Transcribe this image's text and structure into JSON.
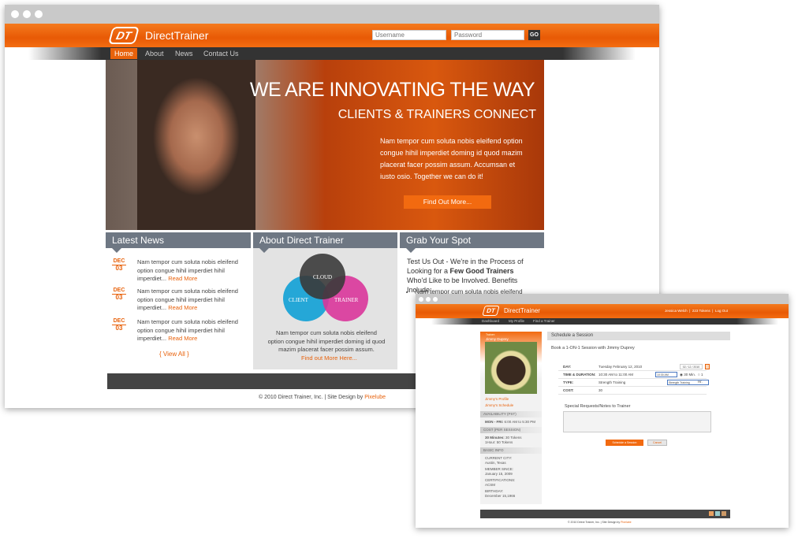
{
  "main_site": {
    "logo": "DirectTrainer",
    "login": {
      "username_placeholder": "Username",
      "password_placeholder": "Password",
      "go": "GO"
    },
    "nav": [
      "Home",
      "About",
      "News",
      "Contact Us"
    ],
    "hero": {
      "title1": "WE ARE INNOVATING THE WAY",
      "title2": "CLIENTS & TRAINERS CONNECT",
      "body": "Nam tempor cum soluta nobis eleifend option congue hihil imperdiet doming id quod mazim placerat facer possim assum. Accumsan et iusto osio. Together we can do it!",
      "cta": "Find Out More..."
    },
    "latest_news": {
      "title": "Latest News",
      "items": [
        {
          "month": "DEC",
          "day": "03",
          "text": "Nam tempor cum soluta nobis eleifend option congue hihil imperdiet hihil imperdiet...",
          "more": "Read More"
        },
        {
          "month": "DEC",
          "day": "03",
          "text": "Nam tempor cum soluta nobis eleifend option congue hihil imperdiet hihil imperdiet...",
          "more": "Read More"
        },
        {
          "month": "DEC",
          "day": "03",
          "text": "Nam tempor cum soluta nobis eleifend option congue hihil imperdiet hihil imperdiet...",
          "more": "Read More"
        }
      ],
      "view_all": "{ View All }"
    },
    "about": {
      "title": "About Direct Trainer",
      "venn": [
        "CLOUD",
        "CLIENT",
        "TRAINER"
      ],
      "body": "Nam tempor cum soluta nobis eleifend option congue hihil imperdiet doming id quod mazim placerat facer possim assum.",
      "more": "Find out More Here..."
    },
    "grab": {
      "title": "Grab Your Spot",
      "intro_a": "Test Us Out - We're in the Process of Looking for a ",
      "intro_bold": "Few Good Trainers",
      "intro_b": " Who'd Like to be Involved. Benefits Include:",
      "bullet": "Nam tempor cum soluta nobis eleifend"
    },
    "footer": {
      "copyright": "© 2010 Direct Trainer, Inc.  |  Site Design by ",
      "designer": "Pixelube"
    }
  },
  "app": {
    "logo": "DirectTrainer",
    "user": "Jessica Welch",
    "tokens": "223 Tokens",
    "logout": "Log Out",
    "nav": [
      "Dashboard",
      "My Profile",
      "Find a Trainer"
    ],
    "trainer": {
      "label": "Trainer:",
      "name": "Jimmy Duprey",
      "links": [
        "Jimmy's Profile",
        "Jimmy's Schedule"
      ],
      "availability_h": "AVAILABILITY (PST)",
      "availability_k": "MON - FRI:",
      "availability_v": "6:00 AM to 5:30 PM",
      "cost_h": "COST (PER SESSION)",
      "cost": [
        [
          "30 Minutes:",
          "30 Tokens"
        ],
        [
          "1Hour:",
          "50 Tokens"
        ]
      ],
      "basic_h": "BASIC INFO",
      "basic": [
        [
          "CURRENT CITY:",
          "Austin, Texas"
        ],
        [
          "MEMBER SINCE:",
          "January 15, 2009"
        ],
        [
          "CERTIFICATIONS:",
          "ACSM"
        ],
        [
          "BIRTHDAY:",
          "December 15,1966"
        ]
      ]
    },
    "schedule": {
      "title": "Schedule a Session",
      "subtitle": "Book a 1-ON-1 Session with Jimmy Duprey",
      "day_l": "DAY:",
      "day_v": "Tuesday February 12, 2010",
      "date_input": "02 / 12 / 2010",
      "time_l": "TIME & DURATION:",
      "time_v": "10:30 AM to 11:00 AM",
      "time_select": "10:30 AM",
      "dur": [
        "30 Min.",
        "1 Hr."
      ],
      "type_l": "TYPE:",
      "type_v": "Strength Training",
      "type_select": "Strength Training",
      "cost_l": "COST:",
      "cost_v": "30",
      "notes_label": "Special Requests/Notes to Trainer",
      "submit": "Schedule a Session",
      "cancel": "Cancel"
    },
    "footer": {
      "copyright": "© 2010 Direct Trainer, Inc.  |  Site Design by ",
      "designer": "Pixelube"
    }
  },
  "colors": {
    "accent": "#e8620c",
    "header_gray": "#6e7783",
    "dark_bar": "#444444"
  }
}
